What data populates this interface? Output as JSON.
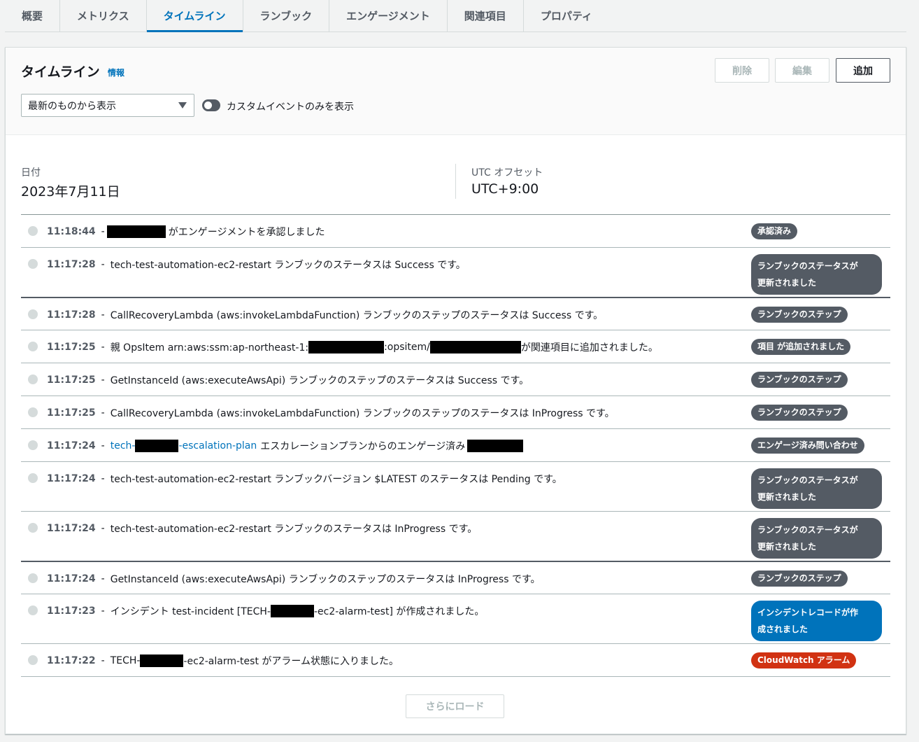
{
  "tabs": [
    "概要",
    "メトリクス",
    "タイムライン",
    "ランブック",
    "エンゲージメント",
    "関連項目",
    "プロパティ"
  ],
  "active_tab_index": 2,
  "panel": {
    "title": "タイムライン",
    "info_link": "情報",
    "buttons": {
      "delete": "削除",
      "edit": "編集",
      "add": "追加"
    },
    "sort_select": "最新のものから表示",
    "toggle_label": "カスタムイベントのみを表示",
    "toggle_on": false
  },
  "meta": {
    "date_label": "日付",
    "date_value": "2023年7月11日",
    "utc_label": "UTC オフセット",
    "utc_value": "UTC+9:00"
  },
  "events": [
    {
      "time": "11:18:44",
      "text_after": "がエンゲージメントを承認しました",
      "badge": "承認済み"
    },
    {
      "time": "11:17:28",
      "text": "tech-test-automation-ec2-restart ランブックのステータスは Success です。",
      "badge_l1": "ランブックのステータスが",
      "badge_l2": "更新されました"
    },
    {
      "time": "11:17:28",
      "text": "CallRecoveryLambda (aws:invokeLambdaFunction) ランブックのステップのステータスは Success です。",
      "badge": "ランブックのステップ"
    },
    {
      "time": "11:17:25",
      "text_a": "親 OpsItem arn:aws:ssm:ap-northeast-1:",
      "text_b": ":opsitem/",
      "text_c": "が関連項目に追加されました。",
      "badge": "項目 が追加されました"
    },
    {
      "time": "11:17:25",
      "text": "GetInstanceId (aws:executeAwsApi) ランブックのステップのステータスは Success です。",
      "badge": "ランブックのステップ"
    },
    {
      "time": "11:17:25",
      "text": "CallRecoveryLambda (aws:invokeLambdaFunction) ランブックのステップのステータスは InProgress です。",
      "badge": "ランブックのステップ"
    },
    {
      "time": "11:17:24",
      "link_a": "tech-",
      "link_b": "-escalation-plan",
      "text": "エスカレーションプランからのエンゲージ済み",
      "badge": "エンゲージ済み問い合わせ"
    },
    {
      "time": "11:17:24",
      "text": "tech-test-automation-ec2-restart ランブックバージョン $LATEST のステータスは Pending です。",
      "badge_l1": "ランブックのステータスが",
      "badge_l2": "更新されました"
    },
    {
      "time": "11:17:24",
      "text": "tech-test-automation-ec2-restart ランブックのステータスは InProgress です。",
      "badge_l1": "ランブックのステータスが",
      "badge_l2": "更新されました"
    },
    {
      "time": "11:17:24",
      "text": "GetInstanceId (aws:executeAwsApi) ランブックのステップのステータスは InProgress です。",
      "badge": "ランブックのステップ"
    },
    {
      "time": "11:17:23",
      "text_a": "インシデント test-incident [TECH-",
      "text_b": "-ec2-alarm-test] が作成されました。",
      "badge_l1": "インシデントレコードが作",
      "badge_l2": "成されました"
    },
    {
      "time": "11:17:22",
      "text_a": "TECH-",
      "text_b": "-ec2-alarm-test がアラーム状態に入りました。",
      "badge": "CloudWatch アラーム"
    }
  ],
  "dash": "-",
  "load_more": "さらにロード",
  "colors": {
    "accent": "#0073bb",
    "badge_gray": "#545b64",
    "badge_blue": "#0073bb",
    "badge_red": "#d13212"
  }
}
